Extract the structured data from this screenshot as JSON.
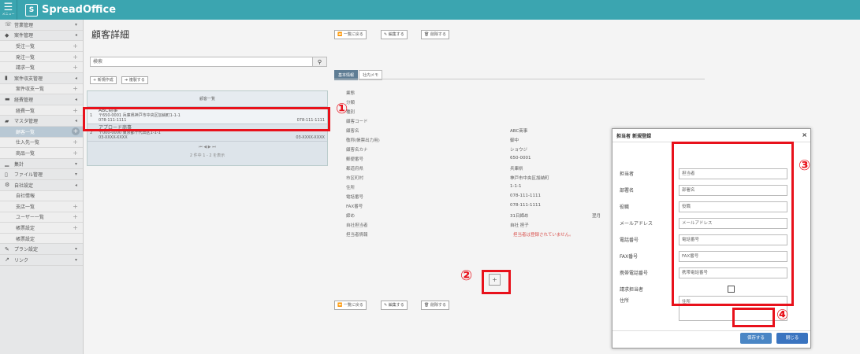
{
  "topbar": {
    "menu_label": "メニュー",
    "app_name": "SpreadOffice"
  },
  "sidebar": {
    "items": [
      {
        "label": "営業管理",
        "icon": "phone-icon",
        "glyph": "☏",
        "kind": "section",
        "arrow": "▾"
      },
      {
        "label": "案件管理",
        "icon": "tag-icon",
        "glyph": "◆",
        "kind": "section",
        "arrow": "◂"
      },
      {
        "label": "受注一覧",
        "kind": "sub"
      },
      {
        "label": "発注一覧",
        "kind": "sub"
      },
      {
        "label": "請求一覧",
        "kind": "sub"
      },
      {
        "label": "案件収支管理",
        "icon": "bar-chart-icon",
        "glyph": "▮",
        "kind": "section",
        "arrow": "◂"
      },
      {
        "label": "案件収支一覧",
        "kind": "sub"
      },
      {
        "label": "経費管理",
        "icon": "card-icon",
        "glyph": "▬",
        "kind": "section",
        "arrow": "◂"
      },
      {
        "label": "経費一覧",
        "kind": "sub"
      },
      {
        "label": "マスタ管理",
        "icon": "truck-icon",
        "glyph": "▰",
        "kind": "section",
        "arrow": "◂"
      },
      {
        "label": "顧客一覧",
        "kind": "sub",
        "active": true
      },
      {
        "label": "仕入先一覧",
        "kind": "sub"
      },
      {
        "label": "商品一覧",
        "kind": "sub"
      },
      {
        "label": "集計",
        "icon": "stats-icon",
        "glyph": "▁",
        "kind": "section",
        "arrow": "▾"
      },
      {
        "label": "ファイル管理",
        "icon": "file-icon",
        "glyph": "▯",
        "kind": "section",
        "arrow": "▾"
      },
      {
        "label": "自社設定",
        "icon": "gear-icon",
        "glyph": "⚙",
        "kind": "section",
        "arrow": "◂"
      },
      {
        "label": "自社情報",
        "kind": "sub",
        "noplus": true
      },
      {
        "label": "支店一覧",
        "kind": "sub"
      },
      {
        "label": "ユーザー一覧",
        "kind": "sub"
      },
      {
        "label": "帳票設定",
        "kind": "sub"
      },
      {
        "label": "帳票設定",
        "kind": "sub",
        "noplus": true
      },
      {
        "label": "プラン設定",
        "icon": "wrench-icon",
        "glyph": "✎",
        "kind": "section",
        "arrow": "▾"
      },
      {
        "label": "リンク",
        "icon": "link-icon",
        "glyph": "↗",
        "kind": "section",
        "arrow": "▾"
      }
    ]
  },
  "main": {
    "title": "顧客詳細",
    "search_placeholder": "検索",
    "search_icon": "search-icon",
    "new_button": "新規作成",
    "copy_button": "複製する",
    "list_header": "顧客一覧",
    "rows": [
      {
        "num": "1",
        "name": "ABC商事",
        "address": "〒650-0001 兵庫県神戸市中央区加納町1-1-1",
        "tel": "078-111-1111",
        "tel2": "078-111-1111"
      },
      {
        "num": "2",
        "name": "アプロード商事",
        "address": "〒000-0000 東京都千代田区1-1-1",
        "tel": "03-XXXX-XXXX",
        "tel2": "03-XXXX-XXXX"
      }
    ],
    "pager_nav": "⏮ ◀ ▶ ⏭",
    "pager_text": "2 件中 1 - 2 を表示",
    "top_actions": [
      "一覧に戻る",
      "編集する",
      "削除する"
    ],
    "bottom_actions": [
      "一覧に戻る",
      "編集する",
      "削除する"
    ],
    "tabs": [
      "基本情報",
      "社内メモ"
    ],
    "fields": [
      {
        "label": "業態",
        "value": ""
      },
      {
        "label": "分類",
        "value": ""
      },
      {
        "label": "種別",
        "value": ""
      },
      {
        "label": "顧客コード",
        "value": ""
      },
      {
        "label": "顧客名",
        "value": "ABC商事"
      },
      {
        "label": "敬称(帳票出力用)",
        "value": "御中"
      },
      {
        "label": "顧客名カナ",
        "value": "ショウジ"
      },
      {
        "label": "郵便番号",
        "value": "650-0001"
      },
      {
        "label": "都道府県",
        "value": "兵庫県"
      },
      {
        "label": "市区町村",
        "value": "神戸市中央区加納町"
      },
      {
        "label": "住所",
        "value": "1-1-1"
      },
      {
        "label": "電話番号",
        "value": "078-111-1111"
      },
      {
        "label": "FAX番号",
        "value": "078-111-1111"
      },
      {
        "label": "締め",
        "value": "31日締め",
        "extra": "翌月"
      },
      {
        "label": "自社担当者",
        "value": "自社 担子"
      },
      {
        "label": "担当者情報",
        "value": "担当者は登録されていません。"
      }
    ]
  },
  "modal": {
    "title": "担当者 新規登録",
    "fields": [
      {
        "label": "担当者",
        "placeholder": "担当者"
      },
      {
        "label": "部署名",
        "placeholder": "部署名"
      },
      {
        "label": "役職",
        "placeholder": "役職"
      },
      {
        "label": "メールアドレス",
        "placeholder": "メールアドレス"
      },
      {
        "label": "電話番号",
        "placeholder": "電話番号"
      },
      {
        "label": "FAX番号",
        "placeholder": "FAX番号"
      },
      {
        "label": "携帯電話番号",
        "placeholder": "携帯電話番号"
      }
    ],
    "billing_label": "請求担当者",
    "address_label": "住所",
    "address_placeholder": "住所",
    "save_label": "保存する",
    "close_label": "閉じる"
  },
  "annotations": [
    "①",
    "②",
    "③",
    "④"
  ],
  "colors": {
    "accent": "#3ba5b0",
    "highlight": "#e8111b",
    "primary_button": "#4a86c5"
  }
}
